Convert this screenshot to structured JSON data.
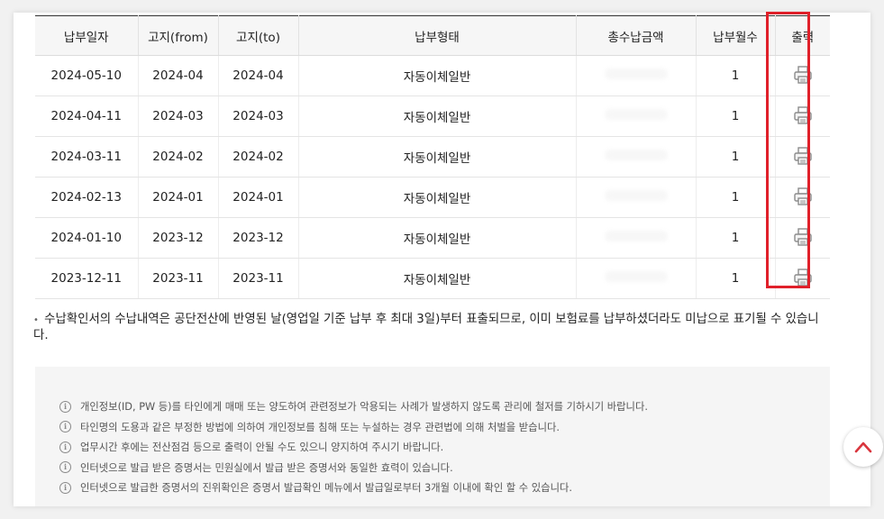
{
  "table": {
    "headers": [
      "납부일자",
      "고지(from)",
      "고지(to)",
      "납부형태",
      "총수납금액",
      "납부월수",
      "출력"
    ],
    "rows": [
      {
        "date": "2024-05-10",
        "from": "2024-04",
        "to": "2024-04",
        "type": "자동이체일반",
        "months": "1"
      },
      {
        "date": "2024-04-11",
        "from": "2024-03",
        "to": "2024-03",
        "type": "자동이체일반",
        "months": "1"
      },
      {
        "date": "2024-03-11",
        "from": "2024-02",
        "to": "2024-02",
        "type": "자동이체일반",
        "months": "1"
      },
      {
        "date": "2024-02-13",
        "from": "2024-01",
        "to": "2024-01",
        "type": "자동이체일반",
        "months": "1"
      },
      {
        "date": "2024-01-10",
        "from": "2023-12",
        "to": "2023-12",
        "type": "자동이체일반",
        "months": "1"
      },
      {
        "date": "2023-12-11",
        "from": "2023-11",
        "to": "2023-11",
        "type": "자동이체일반",
        "months": "1"
      }
    ]
  },
  "notice": {
    "bullet": "•",
    "text": "수납확인서의 수납내역은 공단전산에 반영된 날(영업일 기준 납부 후 최대 3일)부터 표출되므로, 이미 보험료를 납부하셨더라도 미납으로 표기될 수 있습니다."
  },
  "info": {
    "icon": "i",
    "items": [
      "개인정보(ID, PW 등)를 타인에게 매매 또는 양도하여 관련정보가 악용되는 사례가 발생하지 않도록 관리에 철저를 기하시기 바랍니다.",
      "타인명의 도용과 같은 부정한 방법에 의하여 개인정보를 침해 또는 누설하는 경우 관련법에 의해 처벌을 받습니다.",
      "업무시간 후에는 전산점검 등으로 출력이 안될 수도 있으니 양지하여 주시기 바랍니다.",
      "인터넷으로 발급 받은 증명서는 민원실에서 발급 받은 증명서와 동일한 효력이 있습니다.",
      "인터넷으로 발급한 증명서의 진위확인은 증명서 발급확인 메뉴에서 발급일로부터 3개월 이내에 확인 할 수 있습니다."
    ]
  },
  "colors": {
    "highlight": "#e0202a",
    "scroll_top_arrow": "#d9363e"
  },
  "icons": {
    "print": "printer-icon",
    "scroll_top": "chevron-up-icon",
    "info": "info-circle-icon"
  }
}
